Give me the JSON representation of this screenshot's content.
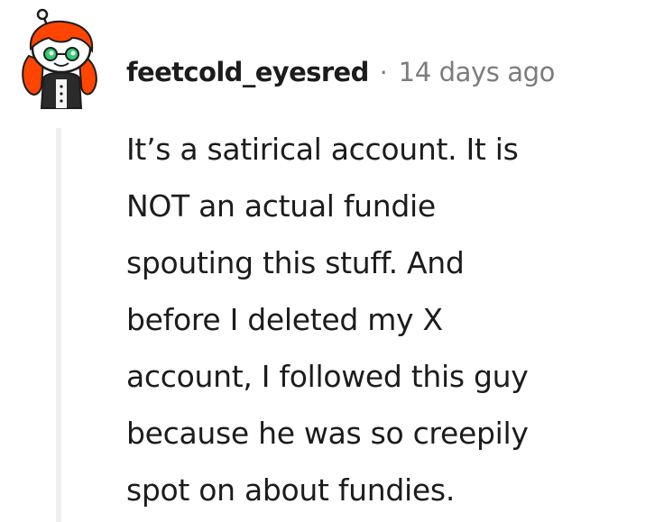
{
  "comment": {
    "username": "feetcold_eyesred",
    "separator": "·",
    "timestamp": "14 days ago",
    "body_lines": [
      "It’s a satirical account. It is",
      "NOT an actual fundie",
      "spouting this stuff. And",
      "before I deleted my X",
      "account, I followed this guy",
      "because he was so creepily",
      "spot on about fundies."
    ]
  },
  "avatar": {
    "icon": "snoo-avatar-icon",
    "hair_color": "#ff4500",
    "eye_color": "#2ecc71"
  },
  "colors": {
    "text": "#1c1c1c",
    "meta": "#7c7c7c",
    "thread_line": "#edeff1"
  }
}
